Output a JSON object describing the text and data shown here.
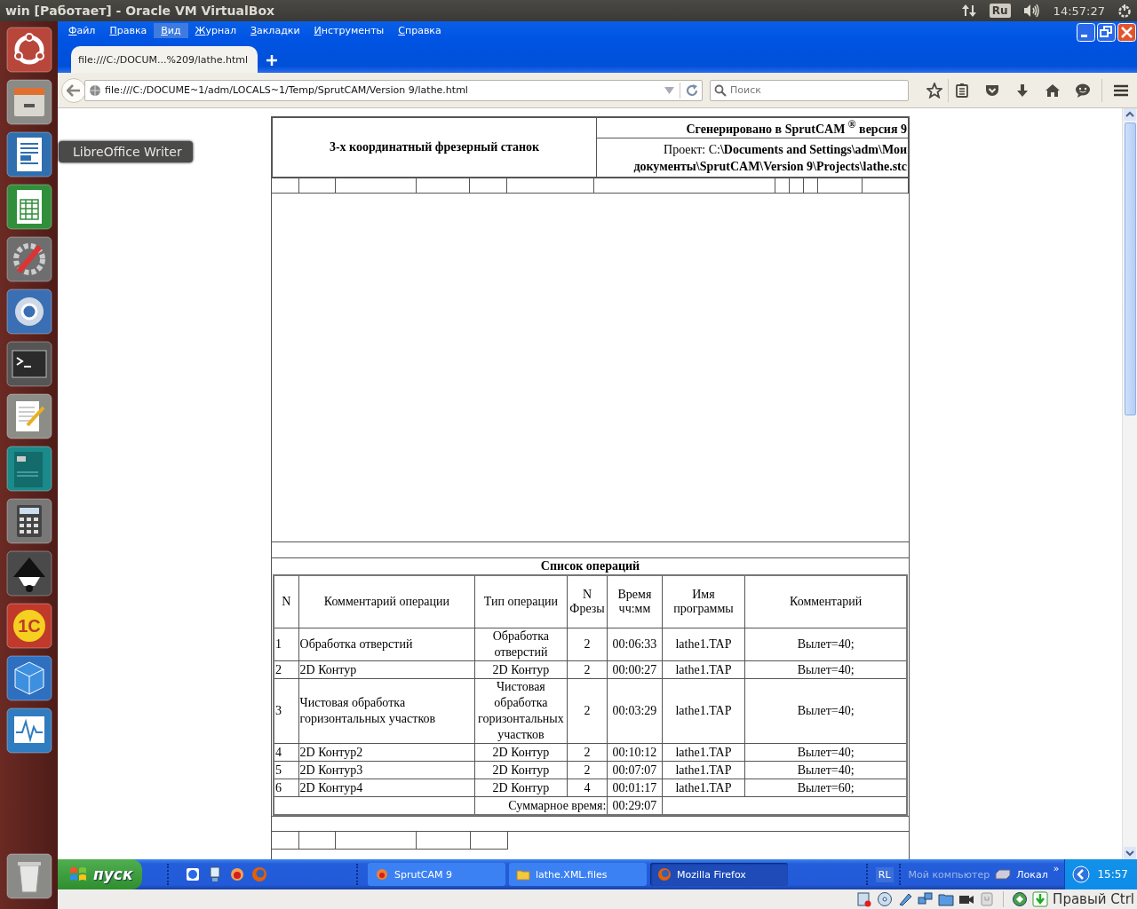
{
  "topbar": {
    "title": "win [Работает] - Oracle VM VirtualBox",
    "keyboard": "Ru",
    "clock": "14:57:27"
  },
  "launcher": {
    "tooltip": "LibreOffice Writer",
    "app_logo": "1С"
  },
  "menu": [
    {
      "label": "Файл",
      "selected": false
    },
    {
      "label": "Правка",
      "selected": false
    },
    {
      "label": "Вид",
      "selected": true
    },
    {
      "label": "Журнал",
      "selected": false
    },
    {
      "label": "Закладки",
      "selected": false
    },
    {
      "label": "Инструменты",
      "selected": false
    },
    {
      "label": "Справка",
      "selected": false
    }
  ],
  "tabs": [
    {
      "label": "file:///C:/DOCUM...%209/lathe.html",
      "selected": true
    }
  ],
  "address": {
    "value": "file:///C:/DOCUME~1/adm/LOCALS~1/Temp/SprutCAM/Version 9/lathe.html"
  },
  "search": {
    "placeholder": "Поиск"
  },
  "document": {
    "machine": "3-х координатный фрезерный станок",
    "generated": "Сгенерировано в SprutCAM $^{®}$ версия 9",
    "project": "Проект: C:**\\Documents and Settings\\adm\\Мои документы\\SprutCAM\\Version 9\\Projects\\lathe.stc**",
    "operations_title": "Список операций",
    "columns": [
      "N",
      "Комментарий операции",
      "Тип операции",
      "N Фрезы",
      "Время чч:мм",
      "Имя программы",
      "Комментарий"
    ],
    "rows": [
      {
        "n": "1",
        "comment": "Обработка отверстий",
        "type": "Обработка отверстий",
        "cutter": "2",
        "time": "00:06:33",
        "program": "lathe1.TAP",
        "note": "Вылет=40;"
      },
      {
        "n": "2",
        "comment": "2D Контур",
        "type": "2D Контур",
        "cutter": "2",
        "time": "00:00:27",
        "program": "lathe1.TAP",
        "note": "Вылет=40;"
      },
      {
        "n": "3",
        "comment": "Чистовая обработка горизонтальных участков",
        "type": "Чистовая обработка горизонтальных участков",
        "cutter": "2",
        "time": "00:03:29",
        "program": "lathe1.TAP",
        "note": "Вылет=40;"
      },
      {
        "n": "4",
        "comment": "2D Контур2",
        "type": "2D Контур",
        "cutter": "2",
        "time": "00:10:12",
        "program": "lathe1.TAP",
        "note": "Вылет=40;"
      },
      {
        "n": "5",
        "comment": "2D Контур3",
        "type": "2D Контур",
        "cutter": "2",
        "time": "00:07:07",
        "program": "lathe1.TAP",
        "note": "Вылет=40;"
      },
      {
        "n": "6",
        "comment": "2D Контур4",
        "type": "2D Контур",
        "cutter": "4",
        "time": "00:01:17",
        "program": "lathe1.TAP",
        "note": "Вылет=60;"
      }
    ],
    "total_label": "Суммарное время:",
    "total_time": "00:29:07"
  },
  "taskbar": {
    "start": "пуск",
    "tasks": [
      {
        "label": "SprutCAM 9",
        "kind": "app",
        "selected": false
      },
      {
        "label": "lathe.XML.files",
        "kind": "folder",
        "selected": false
      },
      {
        "label": "Mozilla Firefox",
        "kind": "browser",
        "selected": true
      }
    ],
    "tray": {
      "language": "RL",
      "toolbar_label": "Мой компьютер",
      "drive_label": "Локал",
      "more": "»",
      "clock": "15:57"
    }
  },
  "status_bar": {
    "host_key": "Правый Ctrl"
  }
}
